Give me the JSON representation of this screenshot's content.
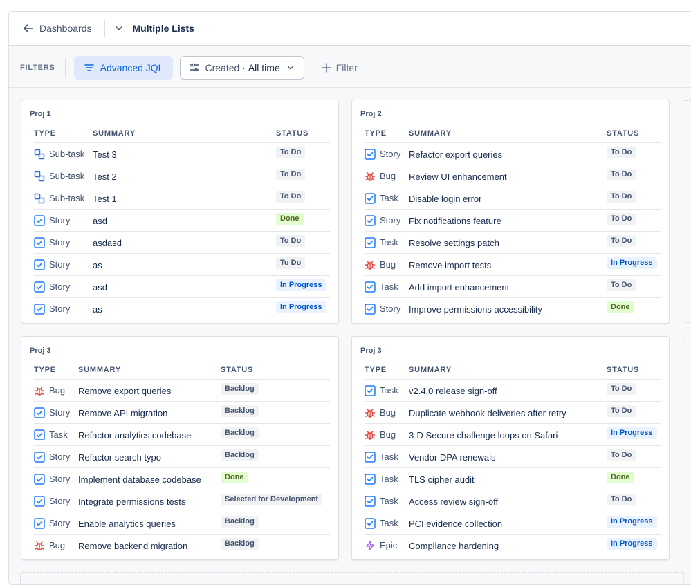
{
  "header": {
    "back_label": "Dashboards",
    "title": "Multiple Lists"
  },
  "filters": {
    "label": "FILTERS",
    "advanced_jql": "Advanced JQL",
    "created_label": "Created ·",
    "created_value": "All time",
    "add_filter": "Filter"
  },
  "columns": {
    "type": "TYPE",
    "summary": "SUMMARY",
    "status": "STATUS"
  },
  "colors": {
    "accent": "#0c66e4",
    "done_bg": "#e3fcd0",
    "progress_bg": "#e9f2ff",
    "todo_bg": "#f1f2f4"
  },
  "cards": [
    {
      "title": "Proj 1",
      "rows": [
        {
          "type": "Sub-task",
          "icon": "subtask-icon",
          "summary": "Test 3",
          "status": "To Do",
          "status_kind": "todo"
        },
        {
          "type": "Sub-task",
          "icon": "subtask-icon",
          "summary": "Test 2",
          "status": "To Do",
          "status_kind": "todo"
        },
        {
          "type": "Sub-task",
          "icon": "subtask-icon",
          "summary": "Test 1",
          "status": "To Do",
          "status_kind": "todo"
        },
        {
          "type": "Story",
          "icon": "story-icon",
          "summary": "asd",
          "status": "Done",
          "status_kind": "done"
        },
        {
          "type": "Story",
          "icon": "story-icon",
          "summary": "asdasd",
          "status": "To Do",
          "status_kind": "todo"
        },
        {
          "type": "Story",
          "icon": "story-icon",
          "summary": "as",
          "status": "To Do",
          "status_kind": "todo"
        },
        {
          "type": "Story",
          "icon": "story-icon",
          "summary": "asd",
          "status": "In Progress",
          "status_kind": "progress"
        },
        {
          "type": "Story",
          "icon": "story-icon",
          "summary": "as",
          "status": "In Progress",
          "status_kind": "progress"
        }
      ]
    },
    {
      "title": "Proj 2",
      "rows": [
        {
          "type": "Story",
          "icon": "story-icon",
          "summary": "Refactor export queries",
          "status": "To Do",
          "status_kind": "todo"
        },
        {
          "type": "Bug",
          "icon": "bug-icon",
          "summary": "Review UI enhancement",
          "status": "To Do",
          "status_kind": "todo"
        },
        {
          "type": "Task",
          "icon": "task-icon",
          "summary": "Disable login error",
          "status": "To Do",
          "status_kind": "todo"
        },
        {
          "type": "Story",
          "icon": "story-icon",
          "summary": "Fix notifications feature",
          "status": "To Do",
          "status_kind": "todo"
        },
        {
          "type": "Task",
          "icon": "task-icon",
          "summary": "Resolve settings patch",
          "status": "To Do",
          "status_kind": "todo"
        },
        {
          "type": "Bug",
          "icon": "bug-icon",
          "summary": "Remove import tests",
          "status": "In Progress",
          "status_kind": "progress"
        },
        {
          "type": "Task",
          "icon": "task-icon",
          "summary": "Add import enhancement",
          "status": "To Do",
          "status_kind": "todo"
        },
        {
          "type": "Story",
          "icon": "story-icon",
          "summary": "Improve permissions accessibility",
          "status": "Done",
          "status_kind": "done"
        }
      ]
    },
    {
      "title": "Proj 3",
      "rows": [
        {
          "type": "Bug",
          "icon": "bug-icon",
          "summary": "Remove export queries",
          "status": "Backlog",
          "status_kind": "todo"
        },
        {
          "type": "Story",
          "icon": "story-icon",
          "summary": "Remove API migration",
          "status": "Backlog",
          "status_kind": "todo"
        },
        {
          "type": "Task",
          "icon": "task-icon",
          "summary": "Refactor analytics codebase",
          "status": "Backlog",
          "status_kind": "todo"
        },
        {
          "type": "Story",
          "icon": "story-icon",
          "summary": "Refactor search typo",
          "status": "Backlog",
          "status_kind": "todo"
        },
        {
          "type": "Story",
          "icon": "story-icon",
          "summary": "Implement database codebase",
          "status": "Done",
          "status_kind": "done"
        },
        {
          "type": "Story",
          "icon": "story-icon",
          "summary": "Integrate permissions tests",
          "status": "Selected for Development",
          "status_kind": "todo"
        },
        {
          "type": "Story",
          "icon": "story-icon",
          "summary": "Enable analytics queries",
          "status": "Backlog",
          "status_kind": "todo"
        },
        {
          "type": "Bug",
          "icon": "bug-icon",
          "summary": "Remove backend migration",
          "status": "Backlog",
          "status_kind": "todo"
        }
      ]
    },
    {
      "title": "Proj 3",
      "rows": [
        {
          "type": "Task",
          "icon": "task-icon",
          "summary": "v2.4.0 release sign-off",
          "status": "To Do",
          "status_kind": "todo"
        },
        {
          "type": "Bug",
          "icon": "bug-icon",
          "summary": "Duplicate webhook deliveries after retry",
          "status": "To Do",
          "status_kind": "todo"
        },
        {
          "type": "Bug",
          "icon": "bug-icon",
          "summary": "3-D Secure challenge loops on Safari",
          "status": "In Progress",
          "status_kind": "progress"
        },
        {
          "type": "Task",
          "icon": "task-icon",
          "summary": "Vendor DPA renewals",
          "status": "To Do",
          "status_kind": "todo"
        },
        {
          "type": "Task",
          "icon": "task-icon",
          "summary": "TLS cipher audit",
          "status": "Done",
          "status_kind": "done"
        },
        {
          "type": "Task",
          "icon": "task-icon",
          "summary": "Access review sign-off",
          "status": "To Do",
          "status_kind": "todo"
        },
        {
          "type": "Task",
          "icon": "task-icon",
          "summary": "PCI evidence collection",
          "status": "In Progress",
          "status_kind": "progress"
        },
        {
          "type": "Epic",
          "icon": "epic-icon",
          "summary": "Compliance hardening",
          "status": "In Progress",
          "status_kind": "progress"
        }
      ]
    }
  ]
}
